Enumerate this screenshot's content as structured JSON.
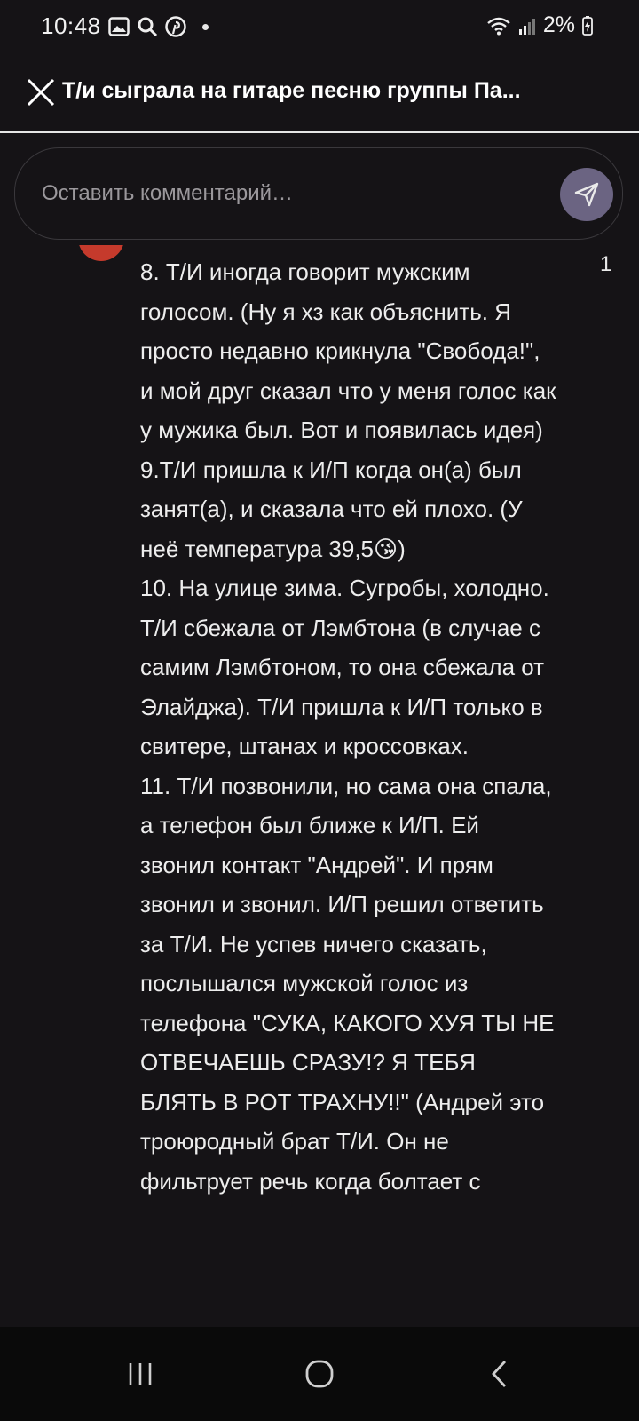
{
  "status_bar": {
    "time": "10:48",
    "battery": "2%",
    "icons": [
      "gallery-icon",
      "search-icon",
      "pinterest-icon",
      "dot-icon",
      "wifi-icon",
      "signal-icon",
      "battery-charging-icon"
    ]
  },
  "header": {
    "title": "Т/и сыграла на гитаре песню группы Па..."
  },
  "comment": {
    "placeholder": "Оставить комментарий…"
  },
  "content": {
    "page_number": "1",
    "text": "8. Т/И иногда говорит мужским голосом. (Ну я хз как объяснить. Я просто недавно крикнула \"Свобода!\", и мой друг сказал что у меня голос как у мужика был. Вот и появилась идея)\n9.Т/И пришла к И/П когда он(а) был занят(а), и сказала что ей плохо. (У неё температура 39,5😘)\n10. На улице зима. Сугробы, холодно. Т/И сбежала от Лэмбтона (в случае с самим Лэмбтоном, то она сбежала от Элайджа). Т/И пришла к И/П только в свитере, штанах и кроссовках.\n11. Т/И позвонили, но сама она спала, а телефон был ближе к И/П. Ей звонил контакт \"Андрей\". И прям звонил и звонил. И/П решил ответить за Т/И. Не успев ничего сказать, послышался мужской голос из телефона \"СУКА, КАКОГО ХУЯ ТЫ НЕ ОТВЕЧАЕШЬ СРАЗУ!? Я ТЕБЯ БЛЯТЬ В РОТ ТРАХНУ!!\" (Андрей это троюродный брат Т/И. Он не фильтрует речь когда болтает с"
  },
  "nav": {
    "buttons": [
      "recent-apps-icon",
      "home-icon",
      "back-icon"
    ]
  },
  "colors": {
    "background": "#151316",
    "send_button": "#6b6482",
    "nav_bar": "#0a0a0a",
    "avatar": "#c53a2c"
  }
}
